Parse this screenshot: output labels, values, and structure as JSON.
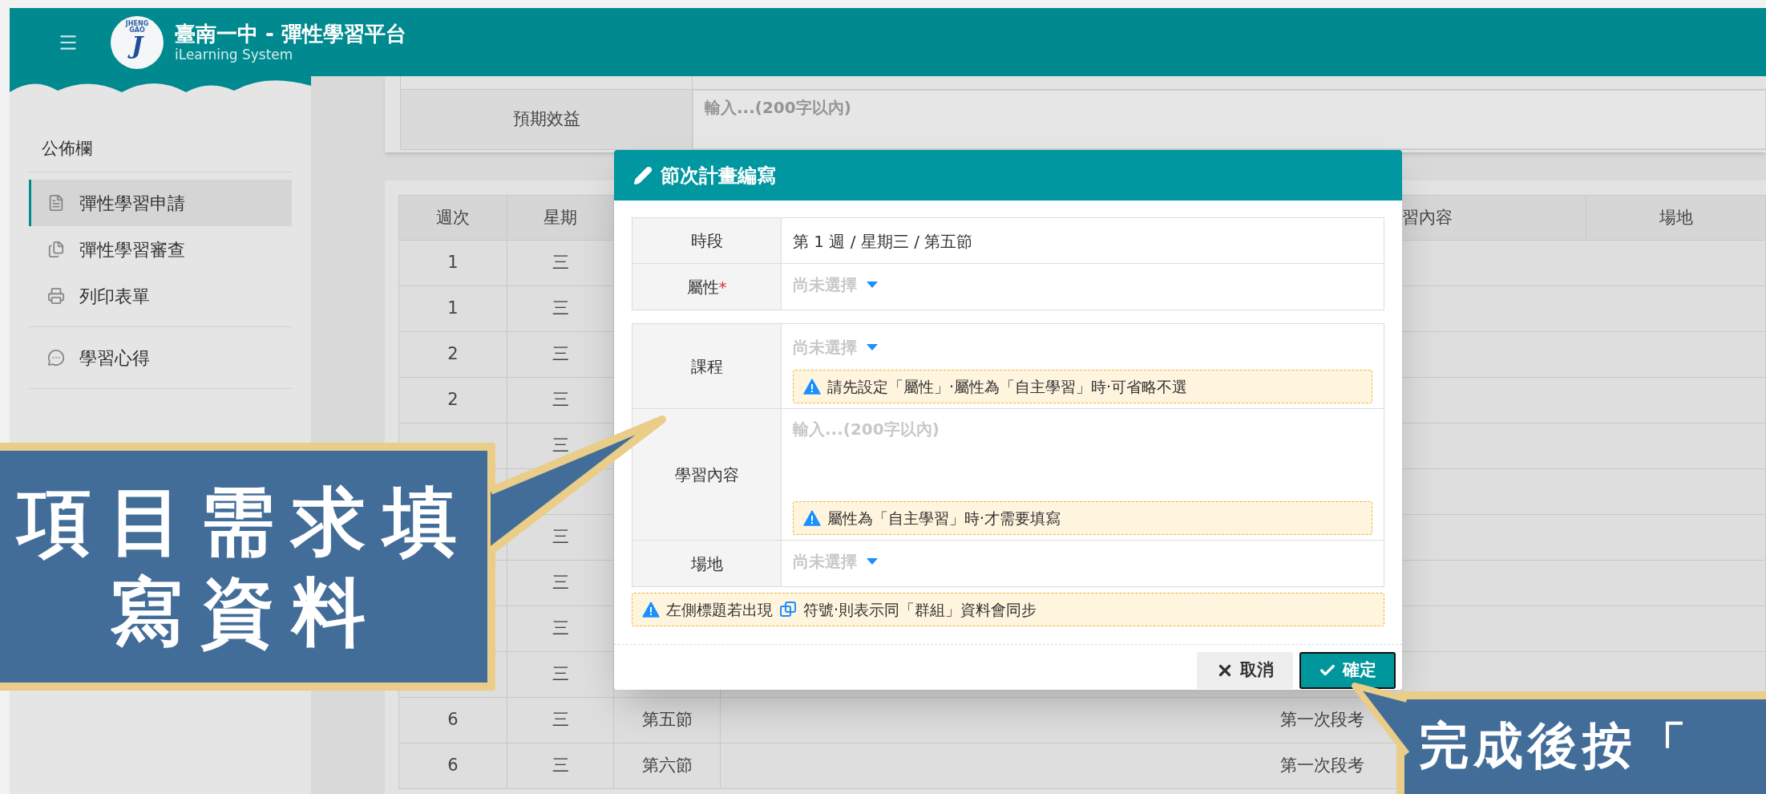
{
  "app": {
    "logo_lines": [
      "JHENG",
      "GAO"
    ],
    "logo_letter": "J",
    "title": "臺南一中 - 彈性學習平台",
    "subtitle": "iLearning System"
  },
  "sidebar": {
    "heading": "公佈欄",
    "sections": [
      {
        "items": [
          {
            "label": "彈性學習申請",
            "selected": true
          },
          {
            "label": "彈性學習審查",
            "selected": false
          },
          {
            "label": "列印表單",
            "selected": false
          }
        ]
      },
      {
        "items": [
          {
            "label": "學習心得",
            "selected": false
          }
        ]
      }
    ]
  },
  "summary_form": {
    "label": "預期效益",
    "placeholder": "輸入...(200字以內)"
  },
  "schedule_table": {
    "header": {
      "week": "週次",
      "day": "星期",
      "content": "習內容",
      "venue": "場地"
    },
    "rows": [
      {
        "week": "1",
        "day": "三"
      },
      {
        "week": "1",
        "day": "三"
      },
      {
        "week": "2",
        "day": "三"
      },
      {
        "week": "2",
        "day": "三"
      },
      {
        "day": "三"
      },
      {},
      {
        "day": "三"
      },
      {
        "day": "三"
      },
      {
        "day": "三"
      },
      {
        "day": "三"
      },
      {
        "week": "6",
        "day": "三",
        "period": "第五節",
        "content": "第一次段考"
      },
      {
        "week": "6",
        "day": "三",
        "period": "第六節",
        "content": "第一次段考"
      }
    ]
  },
  "modal": {
    "title": "節次計畫編寫",
    "required_mark": "*",
    "fields": [
      {
        "kind": "text",
        "label": "時段",
        "required": false,
        "value": "第 1 週 / 星期三 / 第五節"
      },
      {
        "kind": "select",
        "label": "屬性",
        "required": true,
        "placeholder": "尚未選擇"
      }
    ],
    "fields_2": [
      {
        "kind": "select",
        "label": "課程",
        "required": false,
        "placeholder": "尚未選擇",
        "note": "請先設定「屬性」·屬性為「自主學習」時·可省略不選"
      },
      {
        "kind": "textarea",
        "label": "學習內容",
        "required": false,
        "placeholder": "輸入...(200字以內)",
        "note": "屬性為「自主學習」時·才需要填寫"
      },
      {
        "kind": "select",
        "label": "場地",
        "required": false,
        "placeholder": "尚未選擇"
      }
    ],
    "hint": {
      "before": "左側標題若出現",
      "after": "符號·則表示同「群組」資料會同步"
    },
    "buttons": [
      {
        "kind": "cancel",
        "label": "取消",
        "focused": false
      },
      {
        "kind": "confirm",
        "label": "確定",
        "focused": true
      }
    ]
  },
  "callouts": [
    {
      "text": "項目需求填寫資料"
    },
    {
      "text": "完成後按「"
    }
  ]
}
